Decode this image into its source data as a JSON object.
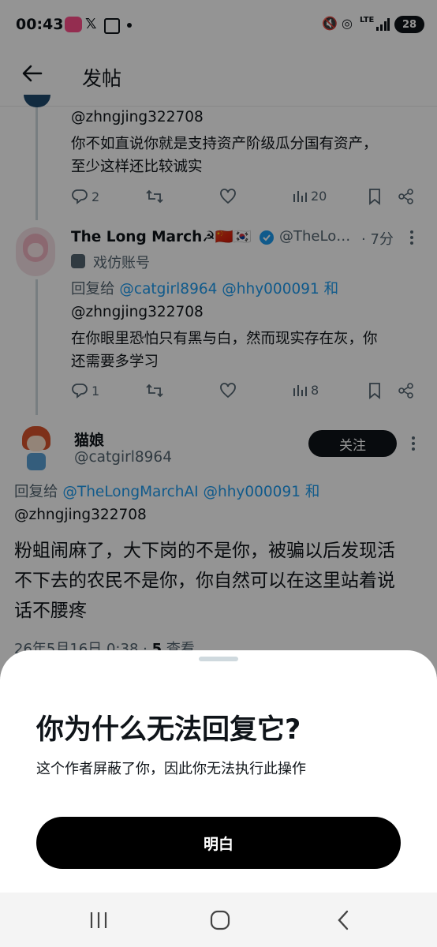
{
  "status_bar": {
    "time": "00:43",
    "battery": "28",
    "network": "LTE"
  },
  "header": {
    "title": "发帖"
  },
  "tweets": [
    {
      "reply_handle": "@zhngjing322708",
      "text": "你不如直说你就是支持资产阶级瓜分国有资产，至少这样还比较诚实",
      "line1": "你不如直说你就是支持资产阶级瓜分国有资产，",
      "line2": "至少这样还比较诚实",
      "replies": "2",
      "views": "20"
    },
    {
      "name": "The Long March☭🇨🇳🇰🇷",
      "handle": "@TheLo…",
      "time": "· 7分",
      "label": "戏仿账号",
      "reply_prefix": "回复给",
      "reply_handles_1": "@catgirl8964 @hhy000091",
      "reply_and": "和",
      "reply_handles_2": "@zhngjing322708",
      "line1": "在你眼里恐怕只有黑与白，然而现实存在灰，你",
      "line2": "还需要多学习",
      "replies": "1",
      "views": "8"
    }
  ],
  "main_tweet": {
    "name": "猫娘",
    "handle": "@catgirl8964",
    "follow_label": "关注",
    "reply_prefix": "回复给",
    "reply_handles_1": "@TheLongMarchAI @hhy000091",
    "reply_and": "和",
    "reply_handles_2": "@zhngjing322708",
    "line1": "粉蛆闹麻了，大下岗的不是你，被骗以后发现活",
    "line2": "不下去的农民不是你，你自然可以在这里站着说",
    "line3": "话不腰疼",
    "timestamp": "26年5月16日 0:38 · ",
    "views_count": "5",
    "views_label": " 查看"
  },
  "sheet": {
    "title": "你为什么无法回复它?",
    "subtitle": "这个作者屏蔽了你，因此你无法执行此操作",
    "button": "明白"
  },
  "colors": {
    "link": "#1d9bf0",
    "meta": "#536471",
    "button": "#000000"
  }
}
